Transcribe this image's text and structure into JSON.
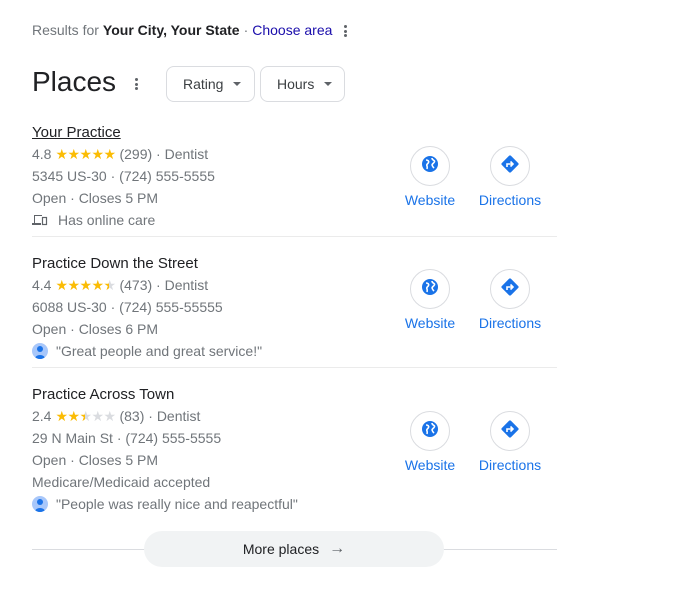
{
  "header": {
    "results_prefix": "Results for",
    "location": "Your City, Your State",
    "separator": "·",
    "choose_area": "Choose area"
  },
  "section": {
    "title": "Places",
    "filters": [
      {
        "label": "Rating"
      },
      {
        "label": "Hours"
      }
    ]
  },
  "colors": {
    "accent": "#1a73e8",
    "link": "#1a0dab",
    "star": "#fbbc04"
  },
  "places": [
    {
      "name": "Your Practice",
      "rating": "4.8",
      "stars": [
        "full",
        "full",
        "full",
        "full",
        "full"
      ],
      "reviews": "(299)",
      "category": "· Dentist",
      "address_phone": "5345 US-30 · (724) 555-5555",
      "hours": "Open · Closes 5 PM",
      "extra": "Has online care",
      "extra_icon": "laptop-phone-icon",
      "website_label": "Website",
      "directions_label": "Directions"
    },
    {
      "name": "Practice Down the Street",
      "rating": "4.4",
      "stars": [
        "full",
        "full",
        "full",
        "full",
        "half"
      ],
      "reviews": "(473)",
      "category": "· Dentist",
      "address_phone": "6088 US-30 · (724) 555-55555",
      "hours": "Open · Closes 6 PM",
      "review_snippet": "\"Great people and great service!\"",
      "website_label": "Website",
      "directions_label": "Directions"
    },
    {
      "name": "Practice Across Town",
      "rating": "2.4",
      "stars": [
        "full",
        "full",
        "half",
        "empty",
        "empty"
      ],
      "reviews": "(83)",
      "category": "· Dentist",
      "address_phone": "29 N Main St · (724) 555-5555",
      "hours": "Open · Closes 5 PM",
      "extra": "Medicare/Medicaid accepted",
      "review_snippet": "\"People was really nice and reapectful\"",
      "website_label": "Website",
      "directions_label": "Directions"
    }
  ],
  "more_places": {
    "label": "More places",
    "icon": "arrow-right-icon"
  }
}
